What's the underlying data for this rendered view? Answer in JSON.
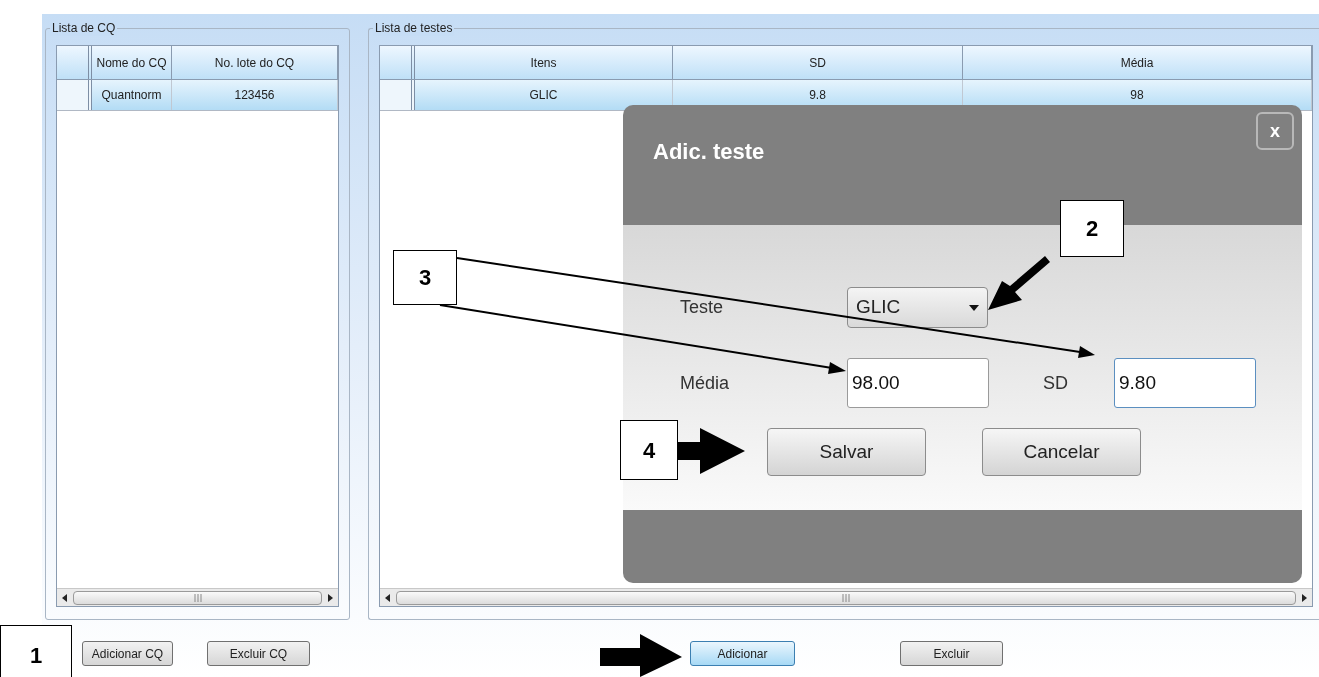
{
  "qc_list": {
    "title": "Lista de CQ",
    "columns": [
      "Nome do CQ",
      "No. lote do CQ"
    ],
    "rows": [
      {
        "cells": [
          "Quantnorm",
          "123456"
        ],
        "selected": true
      }
    ]
  },
  "test_list": {
    "title": "Lista de testes",
    "columns": [
      "Itens",
      "SD",
      "Média"
    ],
    "rows": [
      {
        "cells": [
          "GLIC",
          "9.8",
          "98"
        ],
        "selected": true
      }
    ]
  },
  "qc_buttons": [
    "Adicionar CQ",
    "Excluir CQ"
  ],
  "test_buttons": [
    {
      "label": "Adicionar",
      "focused": true
    },
    {
      "label": "Excluir",
      "focused": false
    }
  ],
  "dialog": {
    "title": "Adic. teste",
    "close": "x",
    "fields": [
      {
        "kind": "select",
        "label": "Teste",
        "value": "GLIC",
        "focused": false
      },
      {
        "kind": "input",
        "label": "Média",
        "value": "98.00",
        "focused": false
      },
      {
        "kind": "input",
        "label": "SD",
        "value": "9.80",
        "focused": true
      }
    ],
    "buttons": [
      "Salvar",
      "Cancelar"
    ]
  },
  "callouts": [
    "1",
    "2",
    "3",
    "4"
  ]
}
